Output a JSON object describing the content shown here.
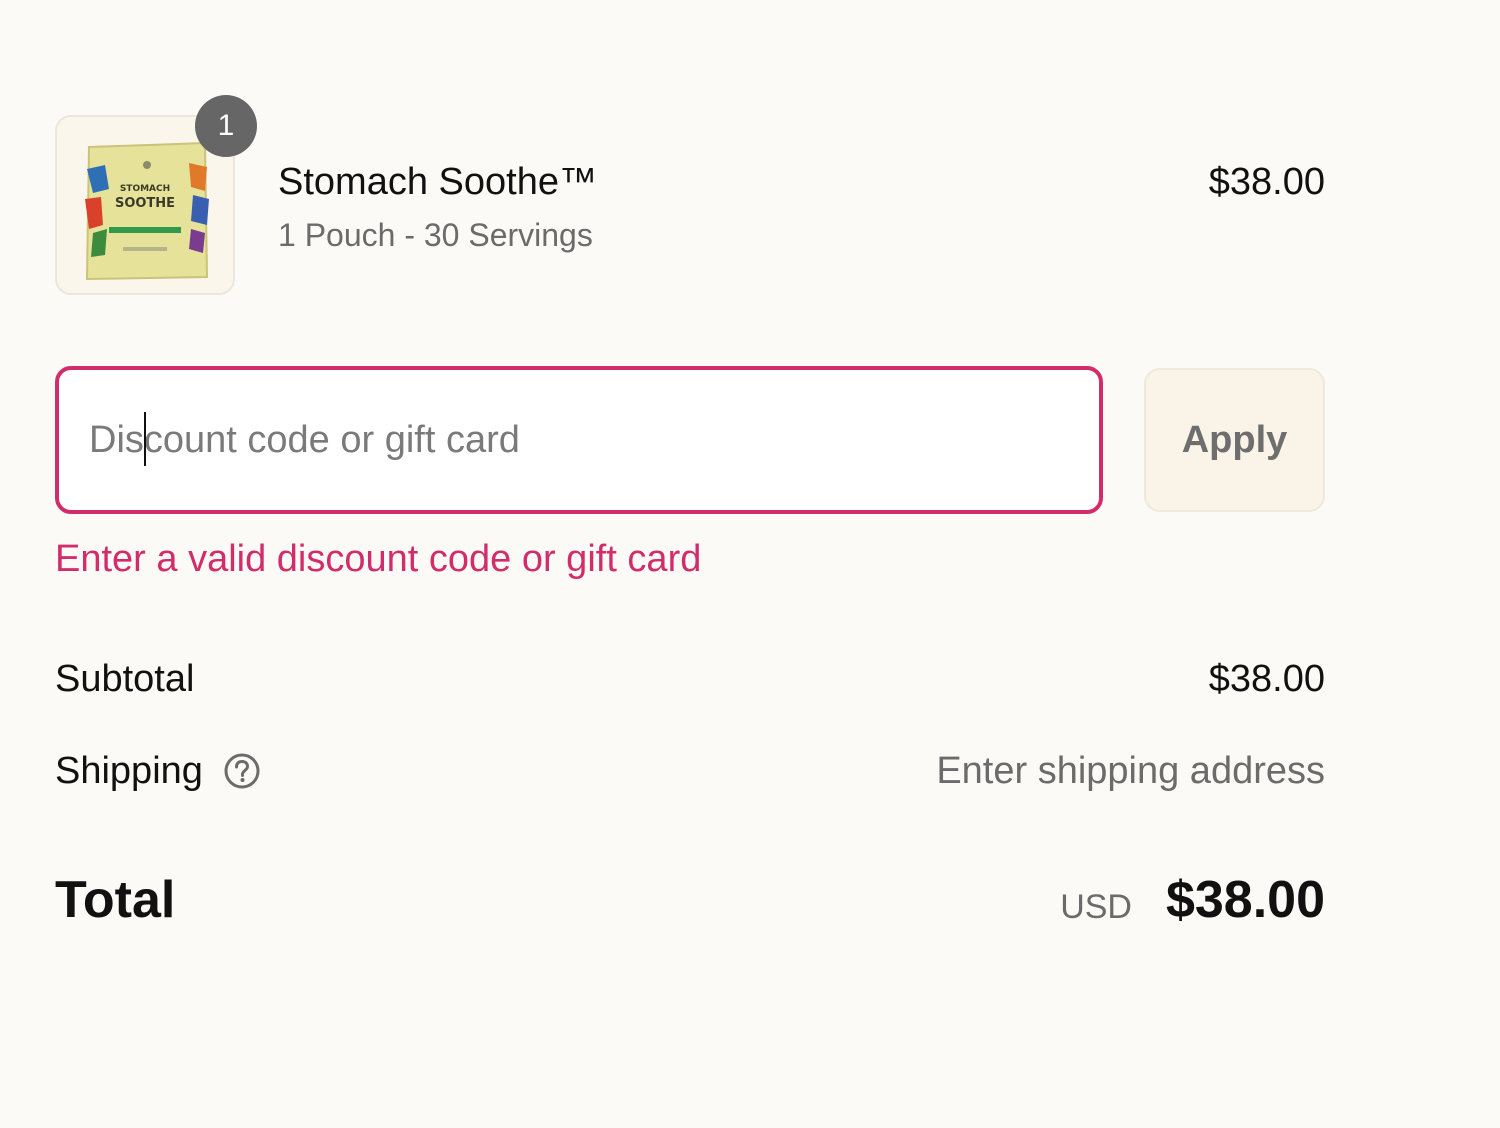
{
  "line_item": {
    "quantity": "1",
    "name": "Stomach Soothe™",
    "variant": "1 Pouch - 30 Servings",
    "price": "$38.00",
    "image_alt": "Stomach Soothe pouch",
    "image_text": "STOMACH SOOTHE"
  },
  "discount": {
    "placeholder": "Discount code or gift card",
    "value": "",
    "apply_label": "Apply",
    "error": "Enter a valid discount code or gift card"
  },
  "totals": {
    "subtotal_label": "Subtotal",
    "subtotal_value": "$38.00",
    "shipping_label": "Shipping",
    "shipping_value": "Enter shipping address",
    "total_label": "Total",
    "currency": "USD",
    "total_value": "$38.00"
  },
  "colors": {
    "error": "#d22d6b",
    "background": "#fcfaf7",
    "apply_bg": "#faf3e8"
  },
  "icons": {
    "shipping_help": "help-circle-icon"
  }
}
